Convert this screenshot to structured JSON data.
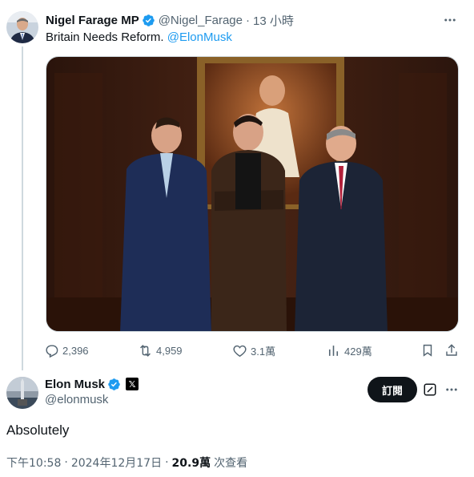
{
  "quoted_tweet": {
    "display_name": "Nigel Farage MP",
    "handle": "@Nigel_Farage",
    "separator": "·",
    "time_ago": "13 小時",
    "text": "Britain Needs Reform.",
    "mention": "@ElonMusk",
    "actions": {
      "replies": "2,396",
      "reposts": "4,959",
      "likes": "3.1萬",
      "views": "429萬"
    }
  },
  "main_tweet": {
    "display_name": "Elon Musk",
    "affiliate_badge": "𝕏",
    "handle": "@elonmusk",
    "subscribe_label": "訂閱",
    "text": "Absolutely",
    "time": "下午10:58",
    "separator": "·",
    "date": "2024年12月17日",
    "views_count": "20.9萬",
    "views_label": "次查看"
  },
  "colors": {
    "accent": "#1d9bf0",
    "text_primary": "#0f1419",
    "text_muted": "#536471",
    "border": "#cfd9de"
  }
}
